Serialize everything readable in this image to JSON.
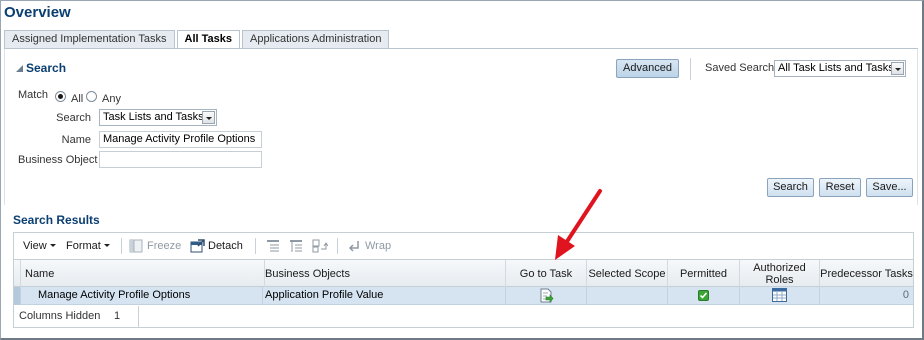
{
  "page": {
    "title": "Overview"
  },
  "tabs": [
    {
      "label": "Assigned Implementation Tasks",
      "active": false
    },
    {
      "label": "All Tasks",
      "active": true
    },
    {
      "label": "Applications Administration",
      "active": false
    }
  ],
  "search": {
    "title": "Search",
    "advanced_label": "Advanced",
    "saved_search_label": "Saved Search",
    "saved_search_value": "All Task Lists and Tasks",
    "match_label": "Match",
    "match_all": "All",
    "match_any": "Any",
    "match_selected": "All",
    "search_label": "Search",
    "search_value": "Task Lists and Tasks",
    "name_label": "Name",
    "name_value": "Manage Activity Profile Options",
    "business_object_label": "Business Object",
    "business_object_value": "",
    "search_button": "Search",
    "reset_button": "Reset",
    "save_button": "Save..."
  },
  "results": {
    "title": "Search Results",
    "toolbar": {
      "view": "View",
      "format": "Format",
      "freeze": "Freeze",
      "detach": "Detach",
      "wrap": "Wrap"
    },
    "columns": [
      "Name",
      "Business Objects",
      "Go to Task",
      "Selected Scope",
      "Permitted",
      "Authorized Roles",
      "Predecessor Tasks"
    ],
    "rows": [
      {
        "name": "Manage Activity Profile Options",
        "business_objects": "Application Profile Value",
        "go_to_task_icon": "go-to-task-icon",
        "selected_scope": "",
        "permitted_icon": "checkmark-icon",
        "authorized_roles_icon": "roles-table-icon",
        "predecessor_tasks": "0"
      }
    ],
    "footer": {
      "columns_hidden_label": "Columns Hidden",
      "columns_hidden_value": "1"
    }
  },
  "colors": {
    "title_blue": "#0b3f72",
    "row_selected": "#d6e4f2",
    "arrow_red": "#e0141e",
    "check_green": "#3aa535"
  }
}
